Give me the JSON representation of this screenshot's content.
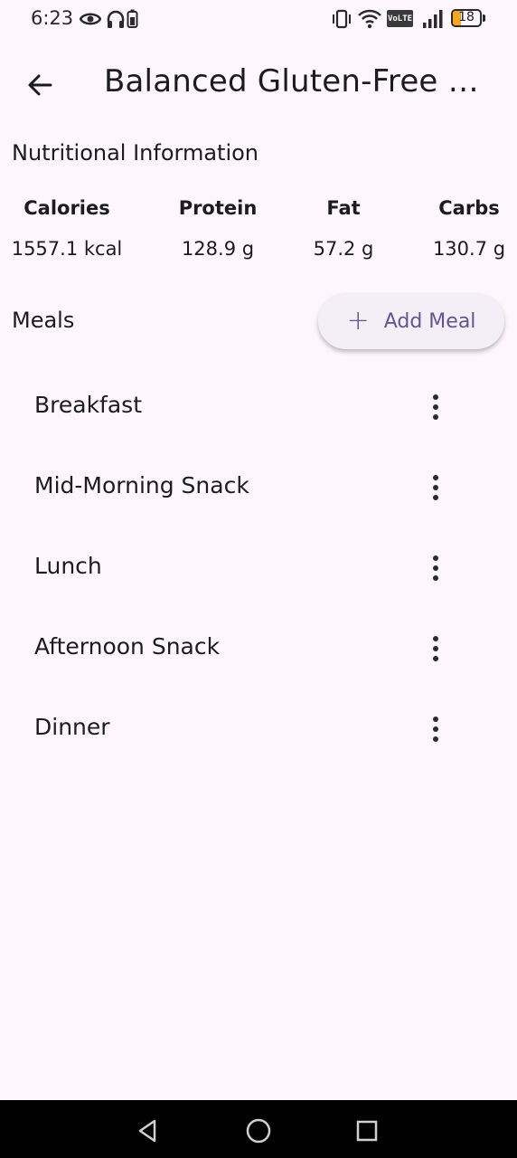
{
  "status_bar": {
    "time": "6:23",
    "battery": "18",
    "network_badge": "VoLTE",
    "icons": [
      "eye-icon",
      "headphones-icon",
      "battery-saver-icon",
      "vibrate-icon",
      "wifi-icon",
      "volte-icon",
      "signal-icon",
      "battery-icon"
    ]
  },
  "app_bar": {
    "back_icon": "arrow-back-icon",
    "title": "Balanced Gluten-Free Diet"
  },
  "nutrition": {
    "section_title": "Nutritional Information",
    "columns": [
      {
        "label": "Calories",
        "value": "1557.1 kcal"
      },
      {
        "label": "Protein",
        "value": "128.9 g"
      },
      {
        "label": "Fat",
        "value": "57.2 g"
      },
      {
        "label": "Carbs",
        "value": "130.7 g"
      }
    ]
  },
  "meals": {
    "section_title": "Meals",
    "add_button_label": "Add Meal",
    "add_icon": "plus-icon",
    "items": [
      {
        "label": "Breakfast"
      },
      {
        "label": "Mid-Morning Snack"
      },
      {
        "label": "Lunch"
      },
      {
        "label": "Afternoon Snack"
      },
      {
        "label": "Dinner"
      }
    ],
    "item_menu_icon": "more-vert-icon"
  },
  "nav_bar": {
    "icons": [
      "back-triangle-icon",
      "home-circle-icon",
      "recents-square-icon"
    ]
  },
  "colors": {
    "background": "#fdf7fd",
    "accent": "#65558f",
    "button_bg": "#f4eef6",
    "battery_low": "#f5a623"
  }
}
